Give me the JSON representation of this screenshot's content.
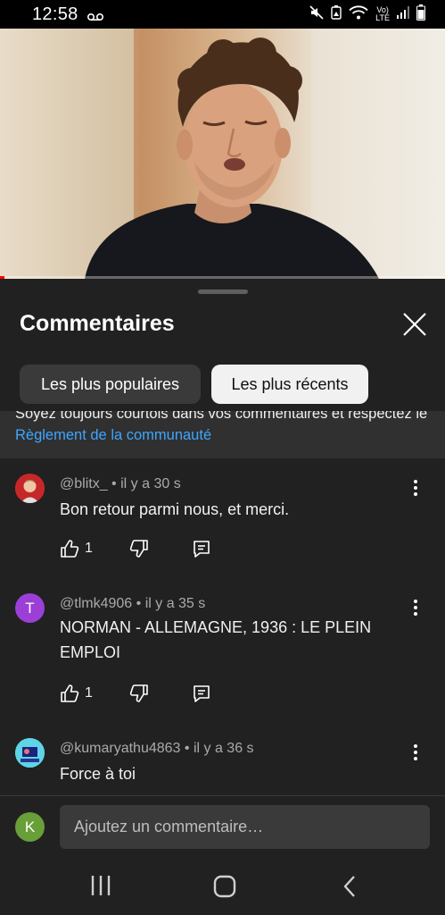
{
  "status_bar": {
    "time": "12:58",
    "volte_label_top": "Vo)",
    "volte_label_bottom": "LTE",
    "icons": [
      "voicemail-icon",
      "mute-icon",
      "vibrate-battery-saver-icon",
      "wifi-icon",
      "signal-icon",
      "battery-icon"
    ]
  },
  "video": {
    "progress": 0.01
  },
  "comments_sheet": {
    "title": "Commentaires",
    "chips": [
      {
        "label": "Les plus populaires",
        "selected": false
      },
      {
        "label": "Les plus récents",
        "selected": true
      }
    ],
    "rules_text": "Soyez toujours courtois dans vos commentaires et respectez le ",
    "rules_link": "Règlement de la communauté",
    "comments": [
      {
        "author": "@blitx_",
        "time": "il y a 30 s",
        "text": "Bon retour parmi nous, et merci.",
        "likes": "1",
        "avatar": "avatar-image"
      },
      {
        "author": "@tlmk4906",
        "time": "il y a 35 s",
        "text": "NORMAN - ALLEMAGNE, 1936 : LE PLEIN EMPLOI",
        "likes": "1",
        "avatar_letter": "T",
        "avatar_color": "#9c3fd6"
      },
      {
        "author": "@kumaryathu4863",
        "time": "il y a 36 s",
        "text": "Force à toi",
        "avatar": "avatar-image"
      }
    ],
    "separator": "•"
  },
  "comment_input": {
    "placeholder": "Ajoutez un commentaire…",
    "user_letter": "K",
    "user_color": "#689f38"
  },
  "colors": {
    "sheet_bg": "#212121",
    "link": "#3ea6ff",
    "chip_selected": "#f1f1f1"
  }
}
